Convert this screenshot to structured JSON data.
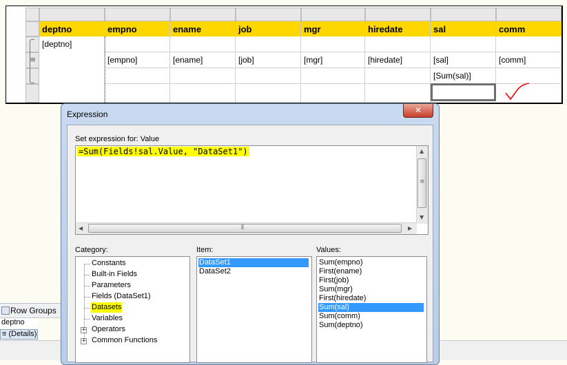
{
  "designer": {
    "headers": [
      "deptno",
      "empno",
      "ename",
      "job",
      "mgr",
      "hiredate",
      "sal",
      "comm"
    ],
    "group_row": [
      "[deptno]",
      "",
      "",
      "",
      "",
      "",
      "",
      ""
    ],
    "detail_row": [
      "",
      "[empno]",
      "[ename]",
      "[job]",
      "[mgr]",
      "[hiredate]",
      "[sal]",
      "[comm]"
    ],
    "total_row": [
      "",
      "",
      "",
      "",
      "",
      "",
      "[Sum(sal)]",
      ""
    ],
    "detail_glyph": "≡"
  },
  "row_groups": {
    "title": "Row Groups",
    "items": [
      "deptno",
      "≡ (Details)"
    ]
  },
  "dialog": {
    "title": "Expression",
    "close_label": "✕",
    "prompt": "Set expression for: Value",
    "expression": "=Sum(Fields!sal.Value, \"DataSet1\")",
    "category_label": "Category:",
    "item_label": "Item:",
    "values_label": "Values:",
    "categories": [
      "Constants",
      "Built-in Fields",
      "Parameters",
      "Fields (DataSet1)",
      "Datasets",
      "Variables",
      "Operators",
      "Common Functions"
    ],
    "items": [
      "DataSet1",
      "DataSet2"
    ],
    "values": [
      "Sum(empno)",
      "First(ename)",
      "First(job)",
      "Sum(mgr)",
      "First(hiredate)",
      "Sum(sal)",
      "Sum(comm)",
      "Sum(deptno)"
    ],
    "selected_category": "Datasets",
    "selected_item": "DataSet1",
    "selected_value": "Sum(sal)"
  },
  "colors": {
    "header_fill": "#ffd700",
    "highlight": "#ffff00",
    "selection": "#3399ff",
    "checkmark": "#ff0000"
  }
}
